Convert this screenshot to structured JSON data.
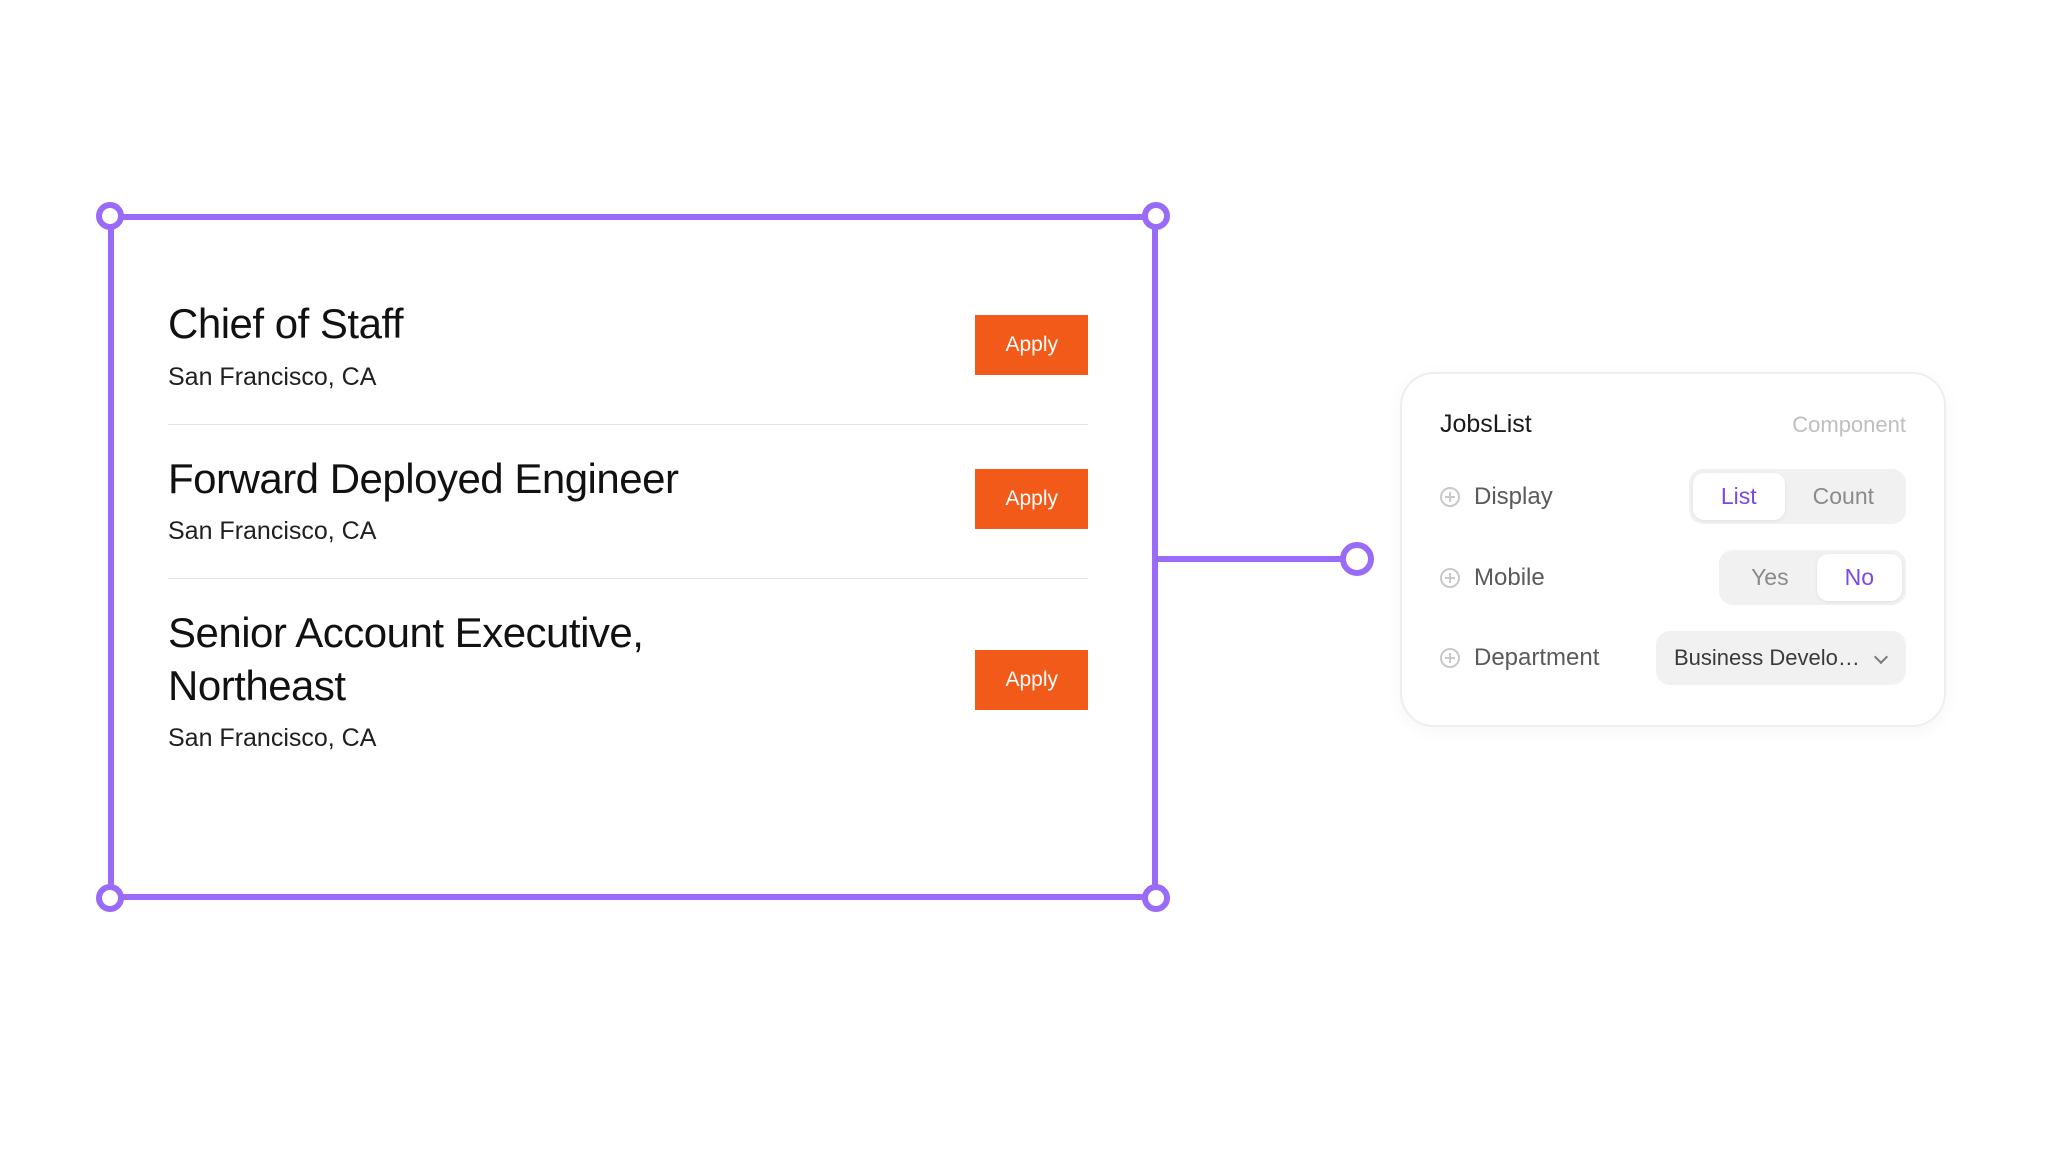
{
  "selection_color": "#9a6af8",
  "jobs": {
    "apply_label": "Apply",
    "items": [
      {
        "title": "Chief of Staff",
        "location": "San Francisco, CA"
      },
      {
        "title": "Forward Deployed Engineer",
        "location": "San Francisco, CA"
      },
      {
        "title": "Senior Account Executive, Northeast",
        "location": "San Francisco, CA"
      }
    ]
  },
  "inspector": {
    "title": "JobsList",
    "subtitle": "Component",
    "props": {
      "display": {
        "label": "Display",
        "options": [
          "List",
          "Count"
        ],
        "value": "List"
      },
      "mobile": {
        "label": "Mobile",
        "options": [
          "Yes",
          "No"
        ],
        "value": "No"
      },
      "department": {
        "label": "Department",
        "value": "Business Develo…"
      }
    }
  }
}
